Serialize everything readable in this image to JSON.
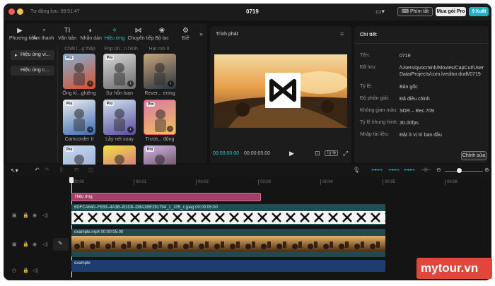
{
  "titlebar": {
    "autosave": "Tự động lưu: 09:51:47",
    "project": "0719",
    "shortcut_label": "Phím tắt",
    "pro_label": "Mua gói Pro",
    "export_label": "Xuất"
  },
  "toolbar": {
    "items": [
      {
        "icon": "media-icon",
        "label": "Phương tiện"
      },
      {
        "icon": "audio-icon",
        "label": "Âm thanh"
      },
      {
        "icon": "text-icon",
        "label": "Văn bản"
      },
      {
        "icon": "sticker-icon",
        "label": "Nhãn dán"
      },
      {
        "icon": "effects-icon",
        "label": "Hiệu ứng"
      },
      {
        "icon": "transition-icon",
        "label": "Chuyển tiếp"
      },
      {
        "icon": "filter-icon",
        "label": "Bộ lọc"
      },
      {
        "icon": "adjust-icon",
        "label": "Điề"
      }
    ],
    "active_index": 4
  },
  "effects": {
    "categories": [
      "Hiệu ứng vi...",
      "Hiệu ứng c..."
    ],
    "top_labels": [
      "Chất l...g thấp",
      "Pop nh...n hình",
      "Hạt mờ II"
    ],
    "items": [
      {
        "label": "Ống kí...ghiêng",
        "pro": "Pro"
      },
      {
        "label": "Sự hỗn loạn",
        "pro": "Pro"
      },
      {
        "label": "Rever... ening",
        "pro": ""
      },
      {
        "label": "Camcorder II",
        "pro": "Pro"
      },
      {
        "label": "Lắy nét xoay",
        "pro": "Pro"
      },
      {
        "label": "Trượt... động",
        "pro": "Pro"
      },
      {
        "label": "",
        "pro": "Pro"
      },
      {
        "label": "",
        "pro": ""
      },
      {
        "label": "",
        "pro": "Pro"
      }
    ]
  },
  "player": {
    "title": "Trình phát",
    "current_time": "00:00:00:00",
    "total_time": "00:00:05:00",
    "ratio_label": "Tỷ lệ"
  },
  "details": {
    "title": "Chi tiết",
    "rows": [
      {
        "key": "Tên:",
        "value": "0719"
      },
      {
        "key": "Đã lưu:",
        "value": "/Users/quocminh/Movies/CapCut/User Data/Projects/com.lveditor.draft/0719"
      },
      {
        "key": "Tỷ lệ:",
        "value": "Bản gốc"
      },
      {
        "key": "Độ phân giải:",
        "value": "Đã điều chỉnh"
      },
      {
        "key": "Không gian màu:",
        "value": "SDR – Rec.709"
      },
      {
        "key": "Tỷ lệ khung hình:",
        "value": "30.00fps"
      },
      {
        "key": "Nhập tài liệu:",
        "value": "Đặt ở vị trí ban đầu"
      }
    ],
    "edit_label": "Chỉnh sửa"
  },
  "timeline": {
    "ruler": [
      "00:00",
      "00:01",
      "00:02",
      "00:03",
      "00:04",
      "00:05",
      "00:06"
    ],
    "effect_clip": "Hiệu ứng",
    "image_clip": "6DFCA640–F833–4A3B–B1D8–DBA1BE291794_1_105_c.jpeg  00:00:05:00",
    "video_clip": "example.mp4  00:00:05:00",
    "audio_clip": "example"
  },
  "watermark": "mytour.vn",
  "colors": {
    "accent": "#2fc4d0",
    "export": "#1bb3c9",
    "effect_track": "#a3406a",
    "image_track": "#1f4d55",
    "audio_track": "#1c3d6e",
    "watermark_bg": "#e0463c"
  }
}
